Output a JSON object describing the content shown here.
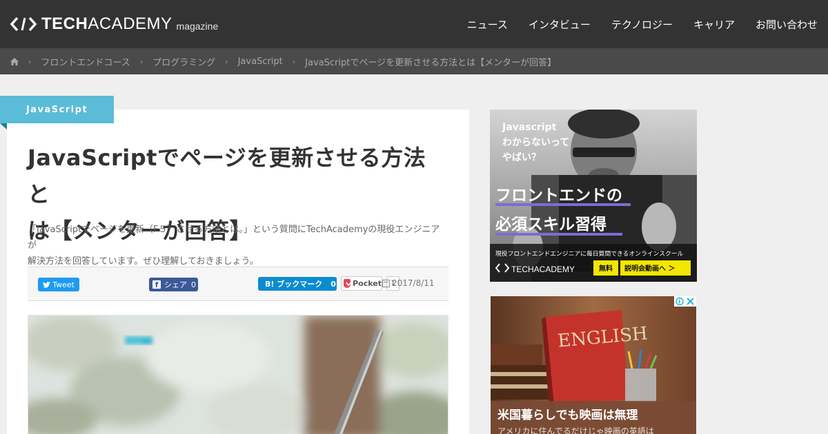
{
  "header": {
    "logo_tech": "TECH",
    "logo_academy": "ACADEMY",
    "logo_magazine": "magazine",
    "nav": [
      "ニュース",
      "インタビュー",
      "テクノロジー",
      "キャリア",
      "お問い合わせ"
    ]
  },
  "breadcrumb": {
    "items": [
      "フロントエンドコース",
      "プログラミング",
      "JavaScript",
      "JavaScriptでページを更新させる方法とは【メンターが回答】"
    ],
    "separator": "›"
  },
  "article": {
    "category": "JavaScript",
    "title_line1": "JavaScriptでページを更新させる方法と",
    "title_line2": "は【メンターが回答】",
    "excerpt_line1": "「JavaScriptでページを更新（F５）させる方法とは。」という質問にTechAcademyの現役エンジニアが",
    "excerpt_line2": "解決方法を回答しています。ぜひ理解しておきましょう。",
    "date": "2017/8/11"
  },
  "share": {
    "tweet": "Tweet",
    "facebook_label": "シェア",
    "facebook_count": "0",
    "hatena_label": "B! ブックマーク",
    "hatena_count": "0",
    "pocket_label": "Pocket",
    "pocket_count": "1"
  },
  "ad1": {
    "line1": "Javascript",
    "line2": "わからないって",
    "line3": "やばい？",
    "headline1": "フロントエンドの",
    "headline2": "必須スキル習得",
    "sub": "現役フロントエンドエンジニアに毎日質問できるオンラインスクール",
    "brand": "TECHACADEMY",
    "badge_free": "無料",
    "cta": "説明会動画へ ＞"
  },
  "ad2": {
    "book_title": "ENGLISH",
    "headline": "米国暮らしでも映画は無理",
    "sub": "アメリカに住んでるだけじゃ映画の英語は"
  },
  "colors": {
    "header_bg": "#333333",
    "breadcrumb_bg": "#4a4a4a",
    "category_bg": "#5bbcd8",
    "twitter": "#1d9bf0",
    "facebook": "#3b5998",
    "hatena": "#0b8ccf",
    "pocket": "#ef4056"
  },
  "icons": [
    "home-icon",
    "calendar-icon",
    "twitter-icon",
    "facebook-icon",
    "pocket-icon",
    "adchoices-icon",
    "close-icon"
  ]
}
